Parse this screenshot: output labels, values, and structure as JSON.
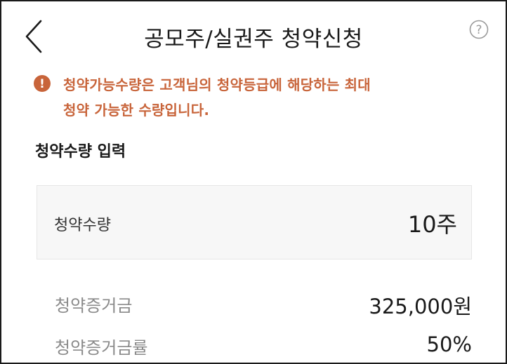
{
  "header": {
    "title": "공모주/실권주 청약신청",
    "back_icon": "chevron-left-icon",
    "help_icon": "question-circle-icon",
    "help_glyph": "?"
  },
  "notice": {
    "icon": "exclamation-circle-icon",
    "icon_glyph": "!",
    "line1": "청약가능수량은 고객님의 청약등급에 해당하는 최대",
    "line2": "청약 가능한 수량입니다.",
    "color": "#c8643a"
  },
  "section": {
    "title": "청약수량 입력"
  },
  "quantity": {
    "label": "청약수량",
    "value": "10주"
  },
  "details": [
    {
      "label": "청약증거금",
      "value": "325,000원"
    },
    {
      "label": "청약증거금률",
      "value": "50%"
    }
  ]
}
